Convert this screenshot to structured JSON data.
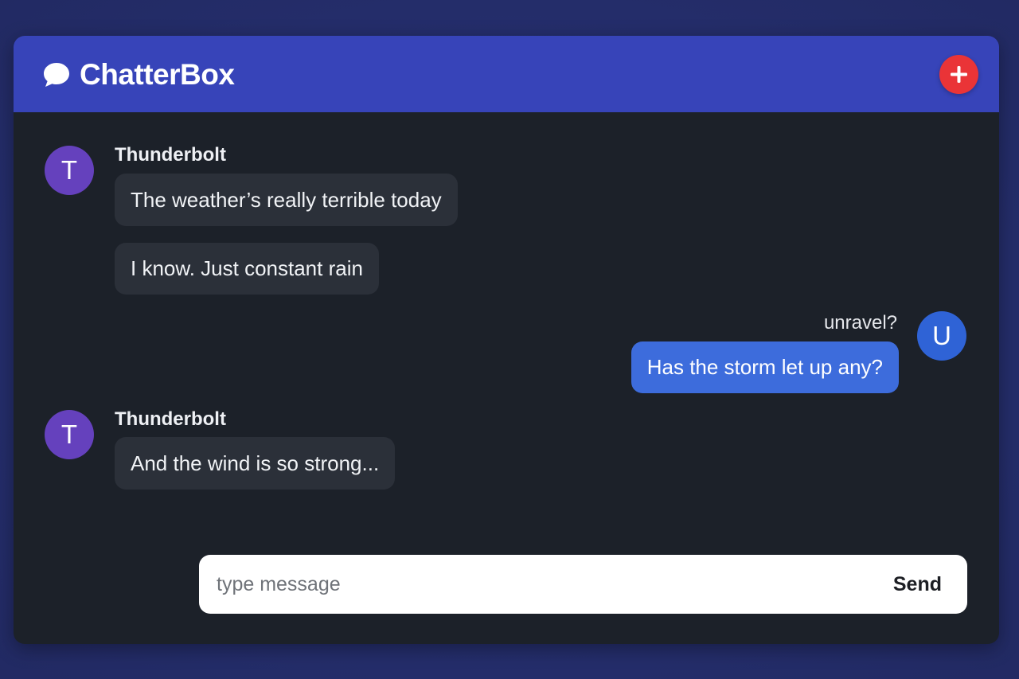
{
  "app": {
    "title": "ChatterBox",
    "icons": {
      "brand": "chat-bubble-icon",
      "add": "plus-icon"
    },
    "colors": {
      "header": "#3744b9",
      "add_button": "#ea3437",
      "incoming_bubble": "#2b3039",
      "outgoing_bubble": "#3d6cdc",
      "avatar_thunderbolt": "#6541bd",
      "avatar_user": "#2f63d6"
    }
  },
  "messages": [
    {
      "sender": "Thunderbolt",
      "avatar": "T",
      "direction": "incoming",
      "text": "The weather’s really terrible today"
    },
    {
      "sender": "Thunderbolt",
      "direction": "incoming",
      "text": "I know. Just constant rain"
    },
    {
      "sender": "unravel?",
      "avatar": "U",
      "direction": "outgoing",
      "text": "Has the storm let up any?"
    },
    {
      "sender": "Thunderbolt",
      "avatar": "T",
      "direction": "incoming",
      "text": "And the wind is so strong..."
    }
  ],
  "composer": {
    "placeholder": "type message",
    "value": "",
    "send_label": "Send"
  }
}
